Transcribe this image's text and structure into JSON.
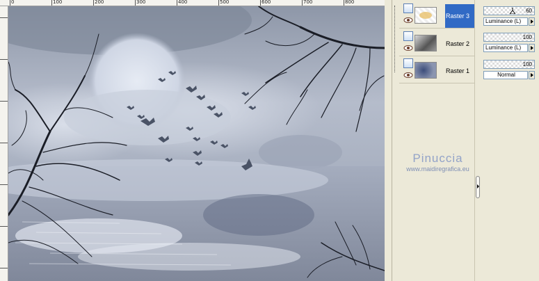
{
  "ruler": {
    "labels": [
      "0",
      "100",
      "200",
      "300",
      "400",
      "500",
      "600",
      "700",
      "800"
    ]
  },
  "watermark": {
    "name": "Pinuccia",
    "url": "www.maidiregrafica.eu"
  },
  "layers": [
    {
      "name": "Raster 3",
      "opacity": "60",
      "blend": "Luminance (L)",
      "selected": true
    },
    {
      "name": "Raster 2",
      "opacity": "100",
      "blend": "Luminance (L)",
      "selected": false
    },
    {
      "name": "Raster 1",
      "opacity": "100",
      "blend": "Normal",
      "selected": false
    }
  ],
  "colors": {
    "selection": "#316ac5",
    "panel": "#ece9d8",
    "watermark": "#8e9fc2"
  },
  "icons": [
    "layer-group-icon",
    "visibility-eye-icon",
    "panel-collapse-arrow-icon",
    "dropdown-arrow-icon",
    "opacity-slider-icon"
  ]
}
